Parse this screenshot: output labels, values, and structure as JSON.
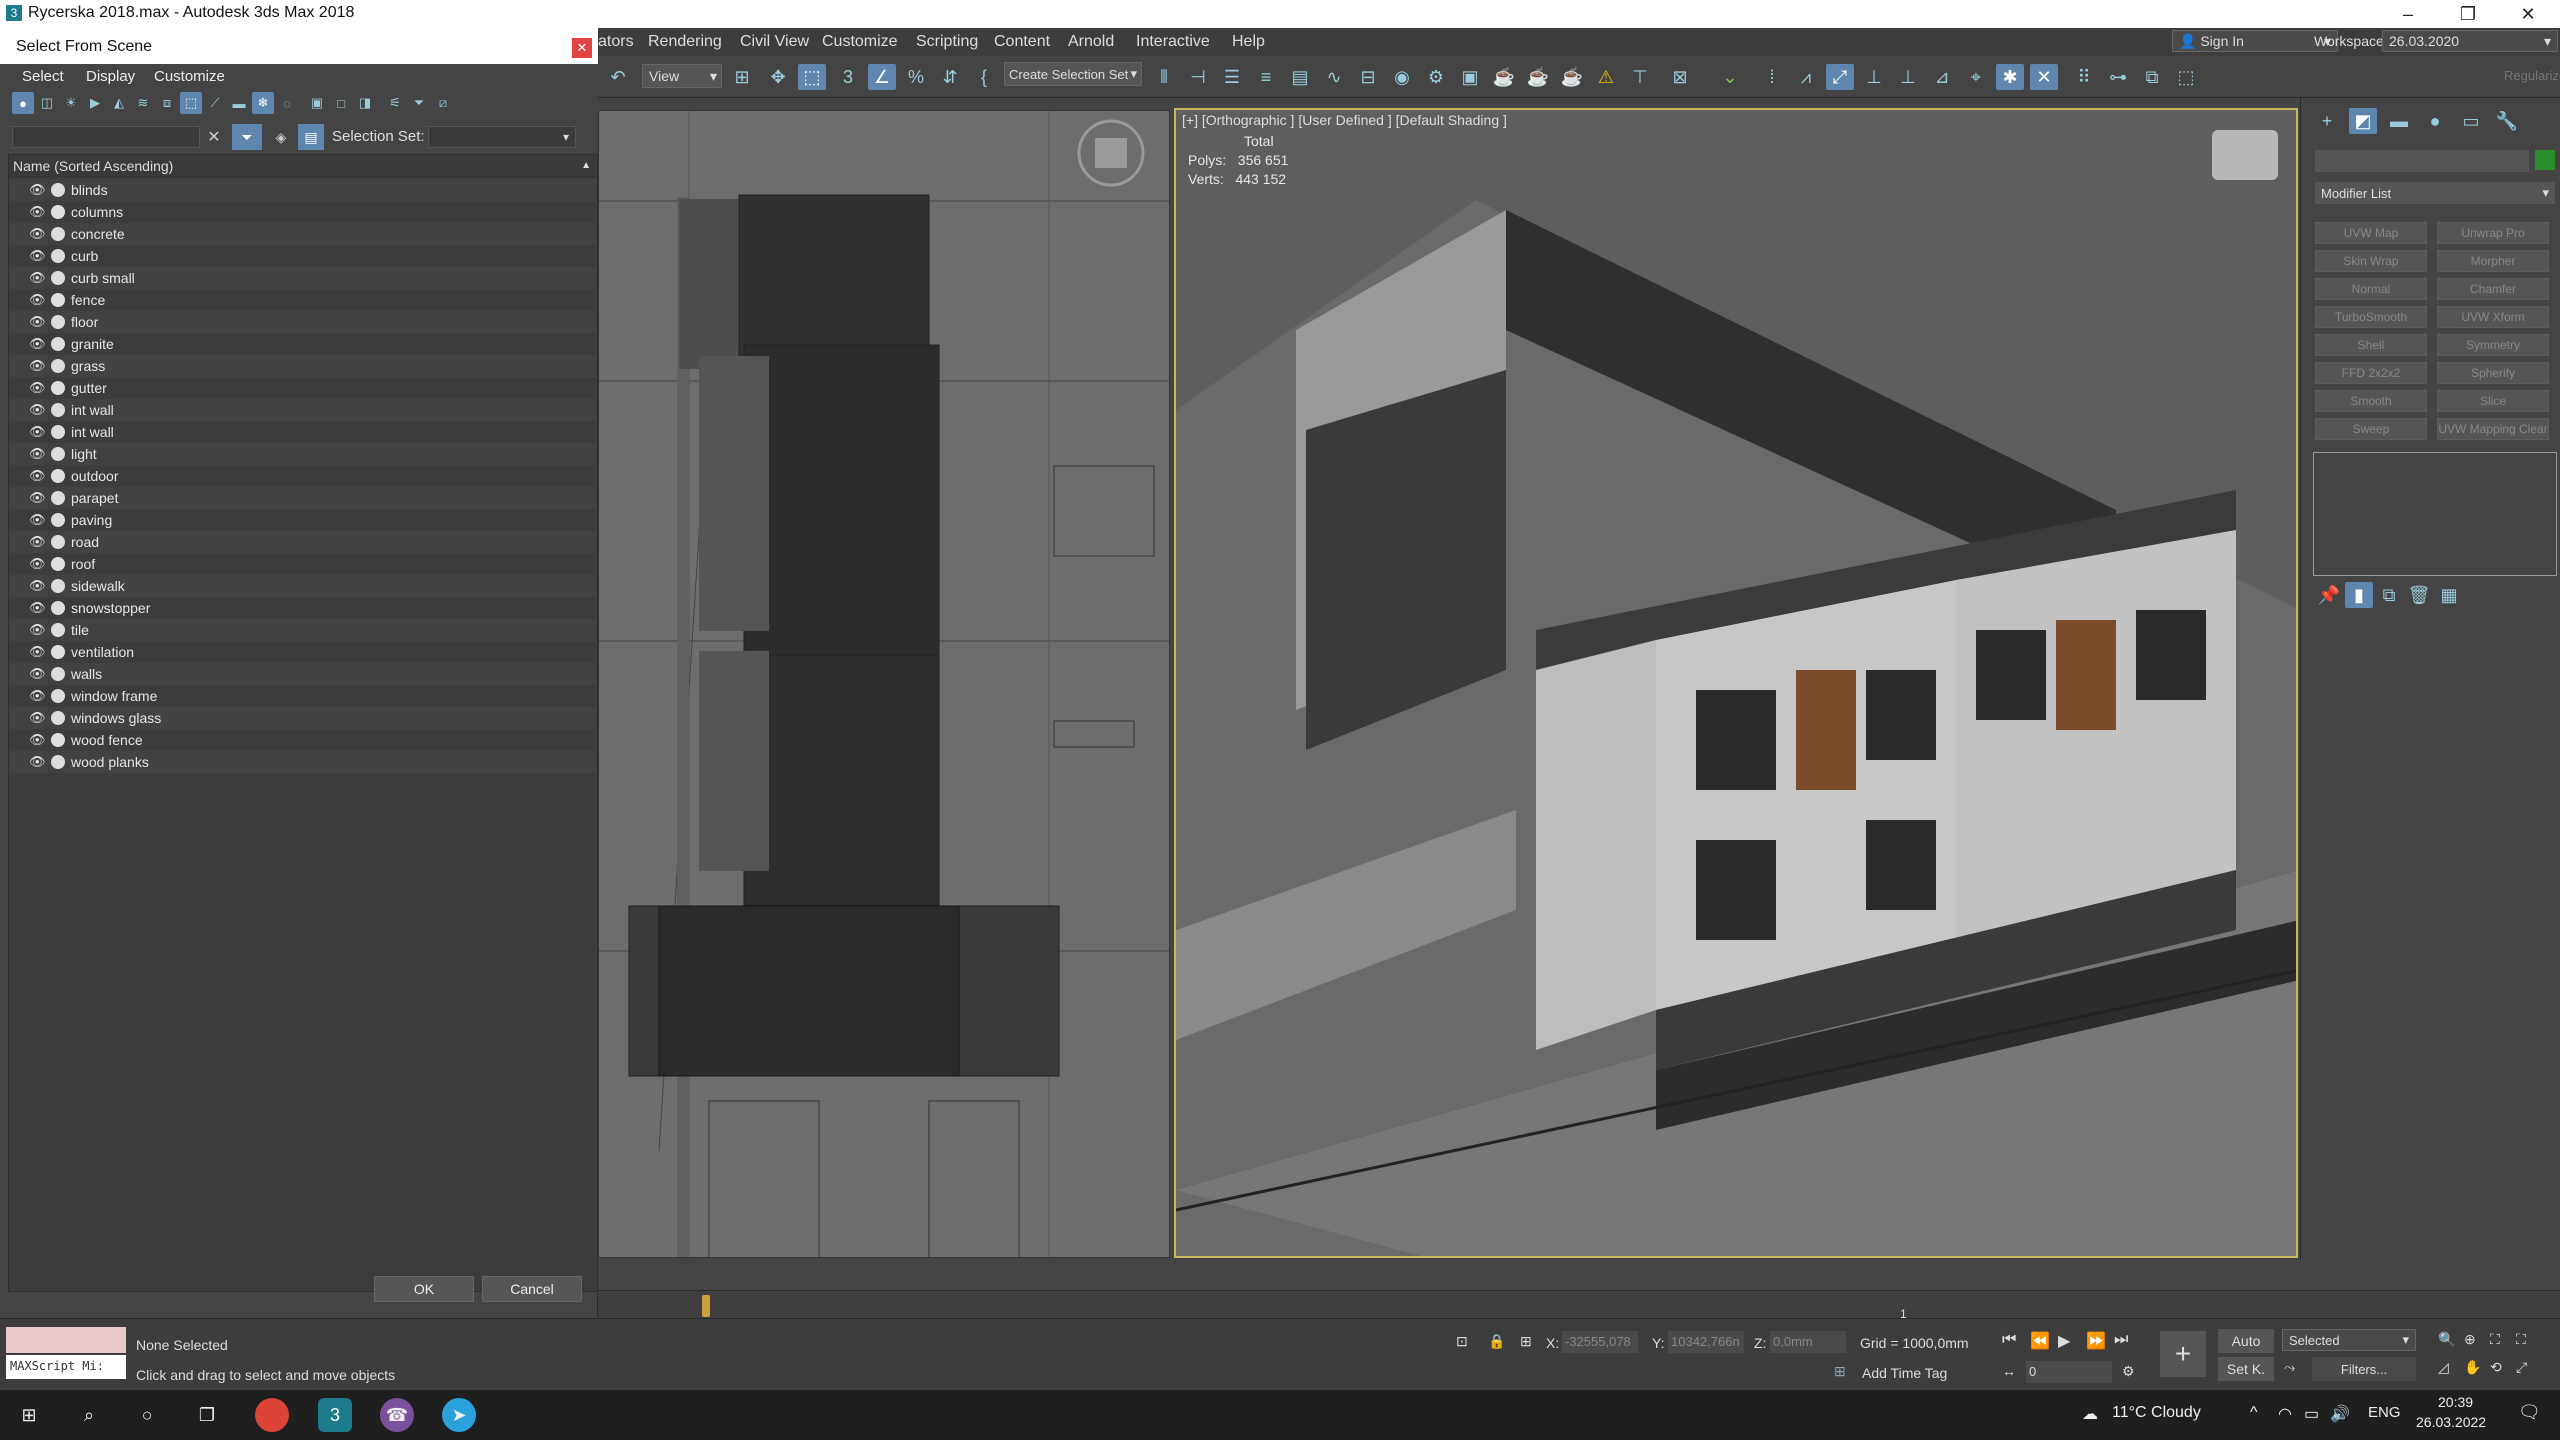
{
  "window": {
    "title": "Rycerska 2018.max - Autodesk 3ds Max 2018"
  },
  "menubar": {
    "items": [
      "ators",
      "Rendering",
      "Civil View",
      "Customize",
      "Scripting",
      "Content",
      "Arnold",
      "Interactive",
      "Help"
    ],
    "signin": "Sign In",
    "workspaces_label": "Workspaces:",
    "workspaces_value": "26.03.2020"
  },
  "toolbar": {
    "view_dropdown": "View",
    "selection_set": "Create Selection Set",
    "regularize": "Regularize"
  },
  "dialog": {
    "title": "Select From Scene",
    "menu": [
      "Select",
      "Display",
      "Customize"
    ],
    "selection_set_label": "Selection Set:",
    "column_header": "Name (Sorted Ascending)",
    "items": [
      "blinds",
      "columns",
      "concrete",
      "curb",
      "curb small",
      "fence",
      "floor",
      "granite",
      "grass",
      "gutter",
      "int wall",
      "int wall",
      "light",
      "outdoor",
      "parapet",
      "paving",
      "road",
      "roof",
      "sidewalk",
      "snowstopper",
      "tile",
      "ventilation",
      "walls",
      "window frame",
      "windows glass",
      "wood fence",
      "wood planks"
    ],
    "ok": "OK",
    "cancel": "Cancel"
  },
  "viewport": {
    "label": "[+] [Orthographic ] [User Defined ] [Default Shading ]",
    "stats_total": "Total",
    "polys_label": "Polys:",
    "polys_value": "356 651",
    "verts_label": "Verts:",
    "verts_value": "443 152"
  },
  "command_panel": {
    "modifier_list": "Modifier List",
    "modifiers": [
      "UVW Map",
      "Unwrap Pro",
      "Skin Wrap",
      "Morpher",
      "Normal",
      "Chamfer",
      "TurboSmooth",
      "UVW Xform",
      "Shell",
      "Symmetry",
      "FFD 2x2x2",
      "Spherify",
      "Smooth",
      "Slice",
      "Sweep",
      "UVW Mapping Clear"
    ]
  },
  "status": {
    "none_selected": "None Selected",
    "hint": "Click and drag to select and move objects",
    "maxscript": "MAXScript Mi:",
    "x_label": "X:",
    "x_value": "-32555,078",
    "y_label": "Y:",
    "y_value": "10342,766n",
    "z_label": "Z:",
    "z_value": "0,0mm",
    "grid": "Grid = 1000,0mm",
    "add_time_tag": "Add Time Tag",
    "frame": "0",
    "auto": "Auto",
    "selected": "Selected",
    "setk": "Set K.",
    "filters": "Filters...",
    "timeline_mark": "1"
  },
  "taskbar": {
    "weather": "11°C  Cloudy",
    "lang": "ENG",
    "time": "20:39",
    "date": "26.03.2022"
  }
}
